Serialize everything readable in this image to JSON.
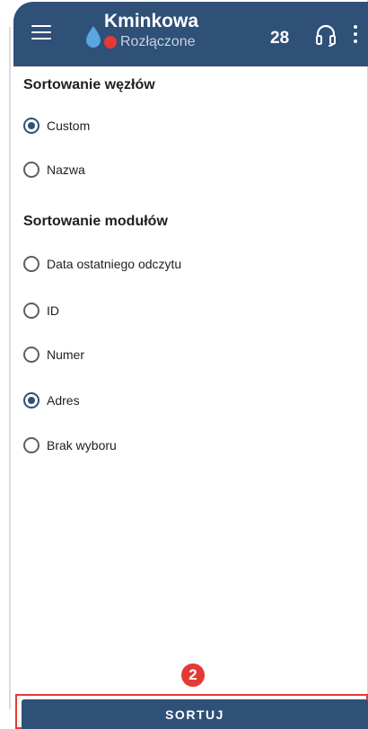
{
  "app_bar": {
    "title": "Kminkowa",
    "status": "Rozłączone",
    "count": "28",
    "icons": [
      "menu-icon",
      "water-drop-icon",
      "headset-icon",
      "more-vert-icon"
    ],
    "colors": {
      "primary": "#2f5077",
      "status_dot": "#e53935"
    }
  },
  "node_sorting": {
    "title": "Sortowanie węzłów",
    "options": [
      {
        "label": "Custom",
        "selected": true
      },
      {
        "label": "Nazwa",
        "selected": false
      }
    ]
  },
  "module_sorting": {
    "title": "Sortowanie modułów",
    "options": [
      {
        "label": "Data ostatniego odczytu",
        "selected": false
      },
      {
        "label": "ID",
        "selected": false
      },
      {
        "label": "Numer",
        "selected": false
      },
      {
        "label": "Adres",
        "selected": true
      },
      {
        "label": "Brak wyboru",
        "selected": false
      }
    ]
  },
  "step_badge": "2",
  "sort_button": {
    "label": "SORTUJ"
  }
}
